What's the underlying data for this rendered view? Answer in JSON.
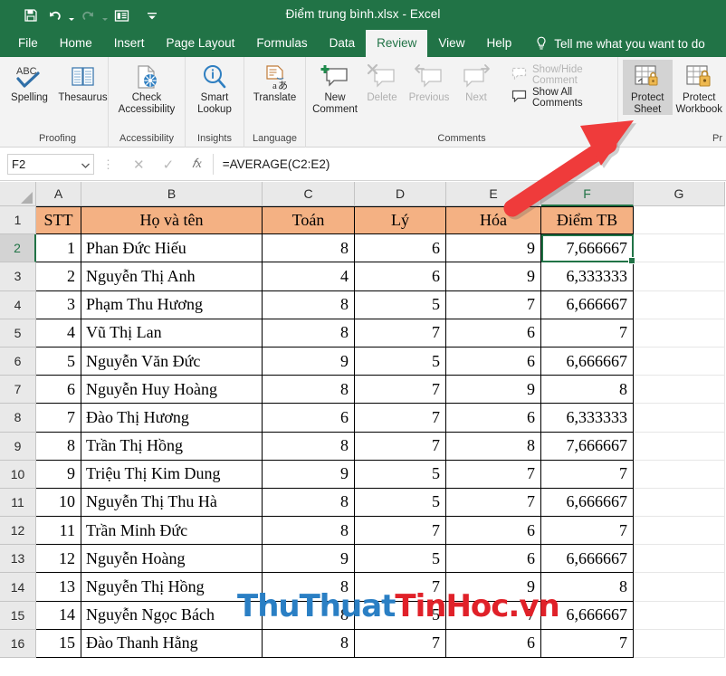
{
  "titlebar": {
    "document_title": "Điểm trung bình.xlsx  -  Excel",
    "quick_access": [
      {
        "name": "save-icon",
        "label": "Save"
      },
      {
        "name": "undo-icon",
        "label": "Undo"
      },
      {
        "name": "redo-icon",
        "label": "Redo"
      },
      {
        "name": "touch-mode-icon",
        "label": "Touch/Mouse Mode"
      },
      {
        "name": "customize-qat-icon",
        "label": "Customize Quick Access Toolbar"
      }
    ]
  },
  "ribbon_tabs": [
    {
      "label": "File",
      "active": false
    },
    {
      "label": "Home",
      "active": false
    },
    {
      "label": "Insert",
      "active": false
    },
    {
      "label": "Page Layout",
      "active": false
    },
    {
      "label": "Formulas",
      "active": false
    },
    {
      "label": "Data",
      "active": false
    },
    {
      "label": "Review",
      "active": true
    },
    {
      "label": "View",
      "active": false
    },
    {
      "label": "Help",
      "active": false
    }
  ],
  "tell_me": "Tell me what you want to do",
  "ribbon_groups": [
    {
      "title": "Proofing",
      "buttons": [
        {
          "label": "Spelling",
          "icon": "spelling-abc-check-icon",
          "disabled": false,
          "selected": false
        },
        {
          "label": "Thesaurus",
          "icon": "thesaurus-book-icon",
          "disabled": false,
          "selected": false
        }
      ]
    },
    {
      "title": "Accessibility",
      "buttons": [
        {
          "label": "Check Accessibility",
          "icon": "check-accessibility-icon",
          "disabled": false,
          "selected": false
        }
      ]
    },
    {
      "title": "Insights",
      "buttons": [
        {
          "label": "Smart Lookup",
          "icon": "smart-lookup-magnifier-icon",
          "disabled": false,
          "selected": false
        }
      ]
    },
    {
      "title": "Language",
      "buttons": [
        {
          "label": "Translate",
          "icon": "translate-icon",
          "disabled": false,
          "selected": false
        }
      ]
    },
    {
      "title": "Comments",
      "buttons": [
        {
          "label": "New Comment",
          "icon": "new-comment-icon",
          "disabled": false,
          "selected": false
        },
        {
          "label": "Delete",
          "icon": "delete-comment-icon",
          "disabled": true,
          "selected": false
        },
        {
          "label": "Previous",
          "icon": "previous-comment-icon",
          "disabled": true,
          "selected": false
        },
        {
          "label": "Next",
          "icon": "next-comment-icon",
          "disabled": true,
          "selected": false
        }
      ],
      "small_buttons": [
        {
          "label": "Show/Hide Comment",
          "icon": "show-hide-comment-icon",
          "disabled": true
        },
        {
          "label": "Show All Comments",
          "icon": "show-all-comments-icon",
          "disabled": false
        }
      ]
    },
    {
      "title": "Pr",
      "buttons": [
        {
          "label": "Protect Sheet",
          "icon": "protect-sheet-icon",
          "disabled": false,
          "selected": true
        },
        {
          "label": "Protect Workbook",
          "icon": "protect-workbook-icon",
          "disabled": false,
          "selected": false
        }
      ]
    }
  ],
  "formula_bar": {
    "name_box": "F2",
    "cancel_icon": "cancel-x-icon",
    "enter_icon": "enter-check-icon",
    "function_icon": "insert-function-fx-icon",
    "formula": "=AVERAGE(C2:E2)"
  },
  "grid": {
    "column_headers": [
      "A",
      "B",
      "C",
      "D",
      "E",
      "F",
      "G"
    ],
    "selected_column": "F",
    "selected_row": "2",
    "active_cell": "F2",
    "row_numbers": [
      "1",
      "2",
      "3",
      "4",
      "5",
      "6",
      "7",
      "8",
      "9",
      "10",
      "11",
      "12",
      "13",
      "14",
      "15",
      "16"
    ],
    "header_row": {
      "A": "STT",
      "B": "Họ và tên",
      "C": "Toán",
      "D": "Lý",
      "E": "Hóa",
      "F": "Điểm TB"
    },
    "rows": [
      {
        "row": "2",
        "stt": "1",
        "name": "Phan Đức Hiếu",
        "toan": "8",
        "ly": "6",
        "hoa": "9",
        "tb": "7,666667"
      },
      {
        "row": "3",
        "stt": "2",
        "name": "Nguyễn Thị Anh",
        "toan": "4",
        "ly": "6",
        "hoa": "9",
        "tb": "6,333333"
      },
      {
        "row": "4",
        "stt": "3",
        "name": "Phạm Thu Hương",
        "toan": "8",
        "ly": "5",
        "hoa": "7",
        "tb": "6,666667"
      },
      {
        "row": "5",
        "stt": "4",
        "name": "Vũ Thị Lan",
        "toan": "8",
        "ly": "7",
        "hoa": "6",
        "tb": "7"
      },
      {
        "row": "6",
        "stt": "5",
        "name": "Nguyễn Văn Đức",
        "toan": "9",
        "ly": "5",
        "hoa": "6",
        "tb": "6,666667"
      },
      {
        "row": "7",
        "stt": "6",
        "name": "Nguyễn Huy Hoàng",
        "toan": "8",
        "ly": "7",
        "hoa": "9",
        "tb": "8"
      },
      {
        "row": "8",
        "stt": "7",
        "name": "Đào Thị Hương",
        "toan": "6",
        "ly": "7",
        "hoa": "6",
        "tb": "6,333333"
      },
      {
        "row": "9",
        "stt": "8",
        "name": "Trần Thị Hồng",
        "toan": "8",
        "ly": "7",
        "hoa": "8",
        "tb": "7,666667"
      },
      {
        "row": "10",
        "stt": "9",
        "name": "Triệu Thị Kim Dung",
        "toan": "9",
        "ly": "5",
        "hoa": "7",
        "tb": "7"
      },
      {
        "row": "11",
        "stt": "10",
        "name": "Nguyễn Thị Thu Hà",
        "toan": "8",
        "ly": "5",
        "hoa": "7",
        "tb": "6,666667"
      },
      {
        "row": "12",
        "stt": "11",
        "name": "Trần Minh Đức",
        "toan": "8",
        "ly": "7",
        "hoa": "6",
        "tb": "7"
      },
      {
        "row": "13",
        "stt": "12",
        "name": "Nguyễn Hoàng",
        "toan": "9",
        "ly": "5",
        "hoa": "6",
        "tb": "6,666667"
      },
      {
        "row": "14",
        "stt": "13",
        "name": "Nguyễn Thị Hồng",
        "toan": "8",
        "ly": "7",
        "hoa": "9",
        "tb": "8"
      },
      {
        "row": "15",
        "stt": "14",
        "name": "Nguyễn Ngọc Bách",
        "toan": "8",
        "ly": "5",
        "hoa": "7",
        "tb": "6,666667"
      },
      {
        "row": "16",
        "stt": "15",
        "name": "Đào Thanh Hằng",
        "toan": "8",
        "ly": "7",
        "hoa": "6",
        "tb": "7"
      }
    ]
  },
  "annotation": {
    "arrow_color": "#ef3b3b",
    "arrow_target": "Protect Sheet"
  },
  "watermark": {
    "part1": "ThuThuat",
    "part2": "TinHoc.vn"
  },
  "colors": {
    "excel_green": "#217346",
    "header_fill": "#f4b183",
    "ribbon_bg": "#f3f3f3",
    "selection_green": "#217346"
  }
}
